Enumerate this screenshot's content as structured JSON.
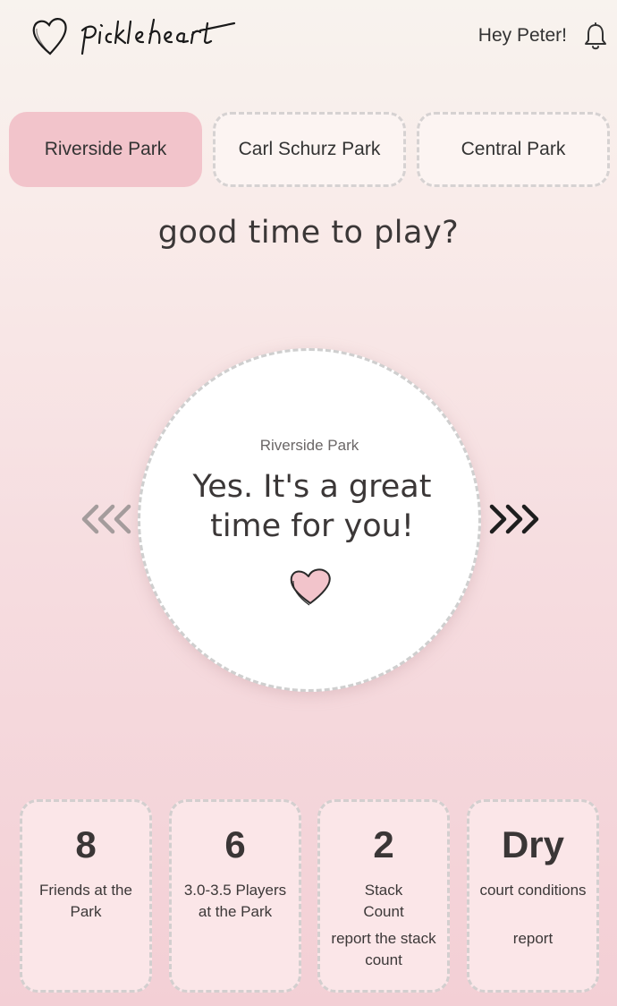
{
  "header": {
    "logo_text": "pickleheart",
    "greeting": "Hey Peter!",
    "bell_icon": "bell-icon"
  },
  "tabs": [
    {
      "label": "Riverside Park",
      "active": true
    },
    {
      "label": "Carl Schurz Park",
      "active": false
    },
    {
      "label": "Central Park",
      "active": false
    }
  ],
  "question": "good time to play?",
  "status": {
    "park": "Riverside Park",
    "message": "Yes. It's a great time for you!",
    "heart_icon": "heart-icon",
    "prev_icon": "chevrons-left-icon",
    "next_icon": "chevrons-right-icon"
  },
  "cards": [
    {
      "value": "8",
      "label": "Friends at the Park"
    },
    {
      "value": "6",
      "label": "3.0-3.5 Players at the Park"
    },
    {
      "value": "2",
      "label": "Stack Count",
      "link": "report the stack count"
    },
    {
      "value": "Dry",
      "label": "court conditions",
      "link": "report"
    }
  ],
  "colors": {
    "active_tab": "#f2c4cb",
    "heart_fill": "#f2c4cb",
    "text": "#3b3737"
  }
}
